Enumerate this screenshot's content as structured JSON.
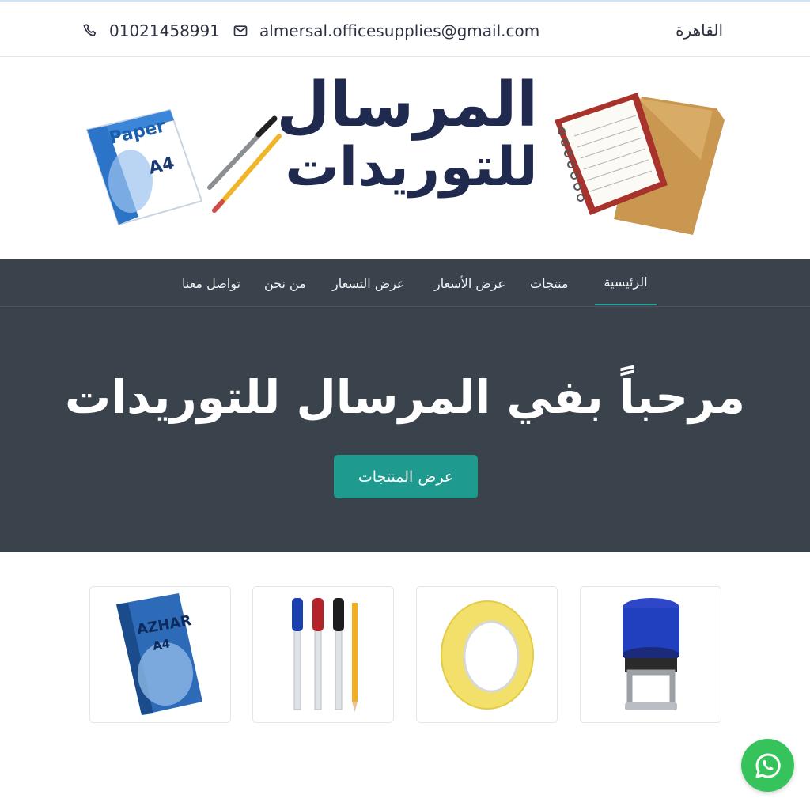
{
  "topbar": {
    "phone": "01021458991",
    "email": "almersal.officesupplies@gmail.com",
    "city": "القاهرة",
    "phone_icon": "phone-icon",
    "email_icon": "mail-icon"
  },
  "banner": {
    "title_line1": "المرسال",
    "title_line2": "للتوريدات",
    "paper_brand": "Paper",
    "paper_size": "A4"
  },
  "nav": {
    "items": [
      {
        "label": "الرئيسية",
        "active": true
      },
      {
        "label": "منتجات",
        "active": false
      },
      {
        "label": "عرض الأسعار",
        "active": false
      },
      {
        "label": "عرض التسعار",
        "active": false
      },
      {
        "label": "من نحن",
        "active": false
      },
      {
        "label": "تواصل معنا",
        "active": false
      }
    ]
  },
  "hero": {
    "title": "مرحباً بفي المرسال للتوريدات",
    "button": "عرض المنتجات"
  },
  "products": [
    {
      "name": "paper-ream",
      "brand": "AZHAR",
      "sub": "A4"
    },
    {
      "name": "pens"
    },
    {
      "name": "tape"
    },
    {
      "name": "stamp"
    }
  ],
  "colors": {
    "accent": "#1e9a8f",
    "dark": "#3a434c",
    "logo": "#1f2a4e",
    "whatsapp": "#36c35b"
  }
}
